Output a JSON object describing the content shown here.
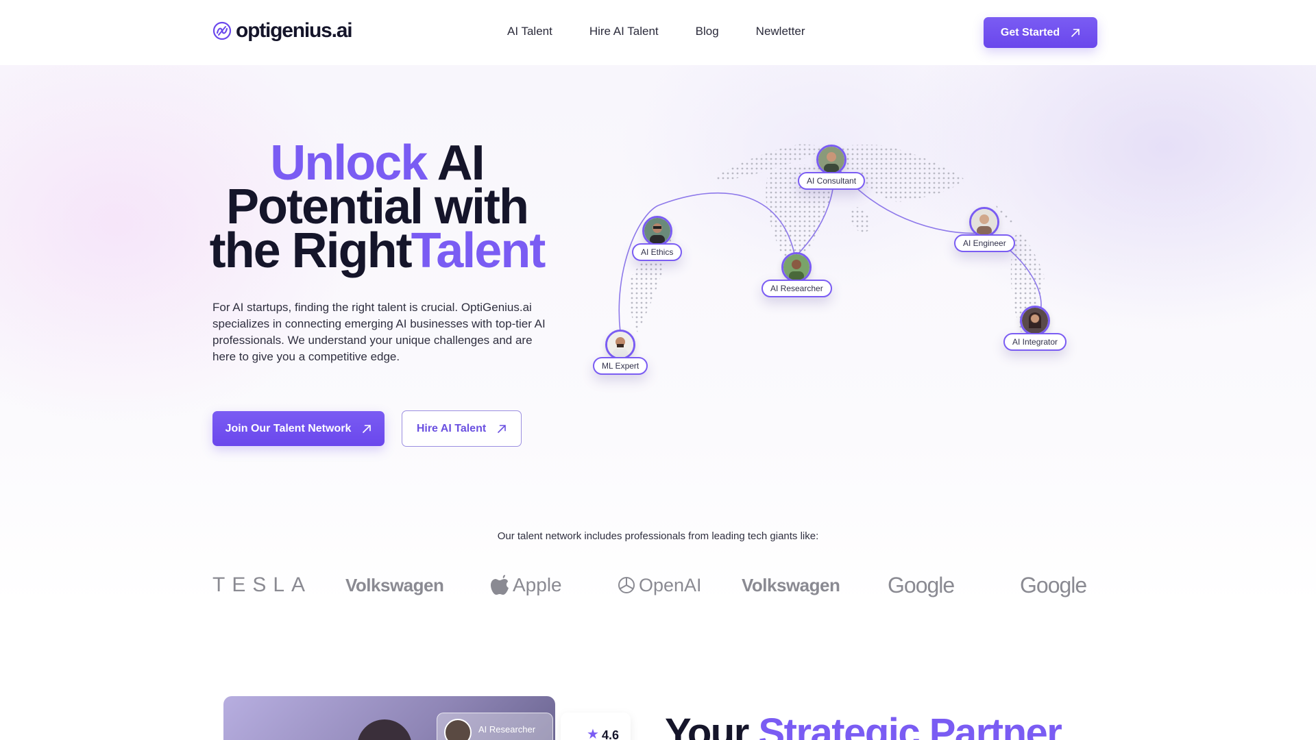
{
  "brand": {
    "name": "optigenius.ai"
  },
  "nav": {
    "items": [
      {
        "label": "AI Talent"
      },
      {
        "label": "Hire AI Talent"
      },
      {
        "label": "Blog"
      },
      {
        "label": "Newletter"
      }
    ],
    "cta_label": "Get Started"
  },
  "hero": {
    "title_accent_1": "Unlock",
    "title_part_1": " AI",
    "title_line_2": "Potential with",
    "title_part_3": "the Right",
    "title_accent_2": "Talent",
    "description": "For AI startups, finding the right talent is crucial. OptiGenius.ai specializes in connecting emerging AI businesses with top-tier AI professionals. We understand your unique challenges and are here to give you a competitive edge.",
    "primary_cta": "Join Our Talent Network",
    "secondary_cta": "Hire AI Talent"
  },
  "globe": {
    "pins": [
      {
        "label": "AI Consultant"
      },
      {
        "label": "AI Ethics"
      },
      {
        "label": "AI Engineer"
      },
      {
        "label": "AI Researcher"
      },
      {
        "label": "AI Integrator"
      },
      {
        "label": "ML Expert"
      }
    ]
  },
  "logos": {
    "tagline": "Our talent network includes professionals from leading tech giants like:",
    "items": [
      "TESLA",
      "Volkswagen",
      "Apple",
      "OpenAI",
      "Volkswagen",
      "Google",
      "Google"
    ]
  },
  "partner": {
    "chip_label": "AI Researcher",
    "rating": "4.6",
    "title_part": "Your ",
    "title_accent": "Strategic Partner"
  },
  "colors": {
    "accent": "#7a5cf3",
    "text": "#15152a"
  }
}
